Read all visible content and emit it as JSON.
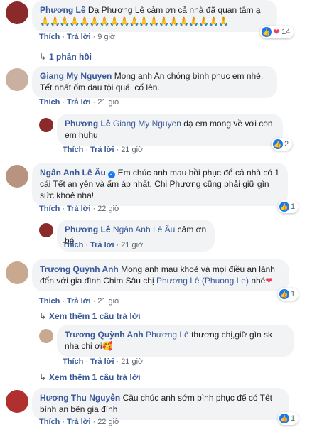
{
  "actions": {
    "like": "Thích",
    "reply": "Trả lời"
  },
  "c1": {
    "author": "Phương Lê",
    "text": "Dạ Phương Lê cảm ơn cả nhà đã quan tâm ạ",
    "emoji": "🙏🙏🙏🙏🙏🙏🙏🙏🙏🙏🙏🙏🙏🙏🙏🙏🙏🙏🙏",
    "time": "9 giờ",
    "reactions": "14",
    "replies_link": "1 phản hồi"
  },
  "c2": {
    "author": "Giang My Nguyen",
    "text": "Mong anh An chóng bình phục em nhé. Tết nhất ốm đau tội quá, cố lên.",
    "time": "21 giờ",
    "reply": {
      "author": "Phương Lê",
      "mention": "Giang My Nguyen",
      "text": "dạ em mong về với con em huhu",
      "time": "21 giờ",
      "reactions": "2"
    }
  },
  "c3": {
    "author": "Ngân Anh Lê Âu",
    "text": "Em chúc anh mau hồi phục để cả nhà có 1 cái Tết an yên và ấm áp nhất. Chị Phương cũng phải giữ gìn sức khoẻ nha!",
    "time": "22 giờ",
    "reactions": "1",
    "reply": {
      "author": "Phương Lê",
      "mention": "Ngân Anh Lê Âu",
      "text": "cảm ơn bé",
      "time": "21 giờ"
    }
  },
  "c4": {
    "author": "Trương Quỳnh Anh",
    "text": "Mong anh mau khoẻ và mọi điều an lành đến với gia đình Chim Sâu chị",
    "mention": "Phương Lê (Phuong Le)",
    "text_end": "nhé",
    "time": "21 giờ",
    "reactions": "1",
    "more_replies": "Xem thêm 1 câu trả lời",
    "reply": {
      "author": "Trương Quỳnh Anh",
      "mention": "Phương Lê",
      "text": "thương chị,giữ gìn sk nha chị ơi",
      "time": "21 giờ",
      "more_replies": "Xem thêm 1 câu trả lời"
    }
  },
  "c5": {
    "author": "Hương Thu Nguyễn",
    "text": "Cầu chúc anh sớm bình phục để có Tết bình an bên gia đình",
    "time": "22 giờ",
    "reactions": "1"
  },
  "colors": {
    "link": "#385898",
    "bubble": "#f2f3f5",
    "meta": "#606770",
    "heart": "#f33e58",
    "like": "#1877f2"
  }
}
